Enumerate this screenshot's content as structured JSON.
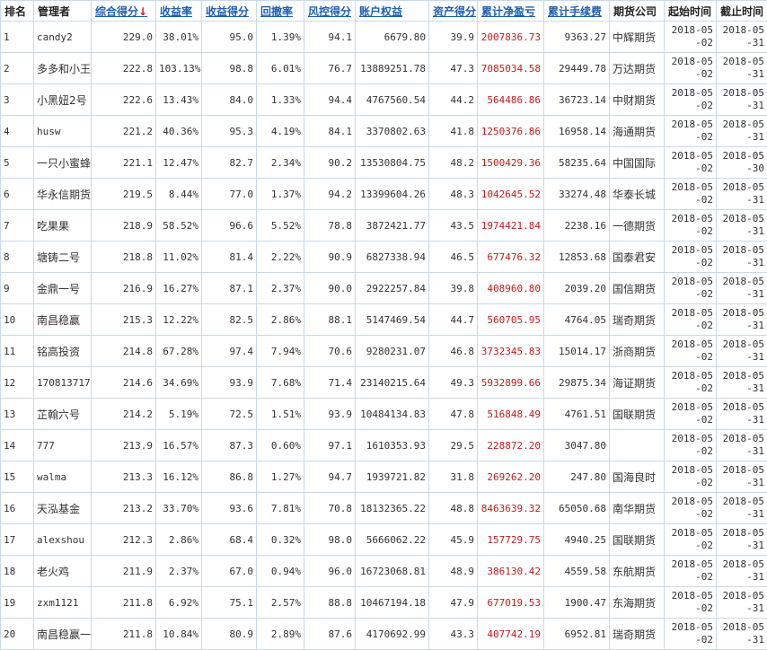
{
  "colors": {
    "header_link": "#1f5fb0",
    "sort_arrow": "#d01818",
    "profit_red": "#c01c1c",
    "grid": "#c8daea"
  },
  "sort_arrow_icon": "arrow-down-icon",
  "headers": {
    "rank": "排名",
    "manager": "管理者",
    "composite": "综合得分",
    "sort_arrow": "↓",
    "return_rate": "收益率",
    "return_score": "收益得分",
    "drawdown": "回撤率",
    "risk_score": "风控得分",
    "equity": "账户权益",
    "asset_score": "资产得分",
    "cum_profit": "累计净盈亏",
    "cum_fee": "累计手续费",
    "company": "期货公司",
    "start": "起始时间",
    "end": "截止时间"
  },
  "rows": [
    {
      "rank": "1",
      "manager": "candy2",
      "composite": "229.0",
      "return_rate": "38.01%",
      "return_score": "95.0",
      "drawdown": "1.39%",
      "risk_score": "94.1",
      "equity": "6679.80",
      "asset_score": "39.9",
      "cum_profit": "2007836.73",
      "cum_fee": "9363.27",
      "company": "中辉期货",
      "start": "2018-05-02",
      "end": "2018-05-31"
    },
    {
      "rank": "2",
      "manager": "多多和小王",
      "composite": "222.8",
      "return_rate": "103.13%",
      "return_score": "98.8",
      "drawdown": "6.01%",
      "risk_score": "76.7",
      "equity": "13889251.78",
      "asset_score": "47.3",
      "cum_profit": "7085034.58",
      "cum_fee": "29449.78",
      "company": "万达期货",
      "start": "2018-05-02",
      "end": "2018-05-31"
    },
    {
      "rank": "3",
      "manager": "小黑妞2号",
      "composite": "222.6",
      "return_rate": "13.43%",
      "return_score": "84.0",
      "drawdown": "1.33%",
      "risk_score": "94.4",
      "equity": "4767560.54",
      "asset_score": "44.2",
      "cum_profit": "564486.86",
      "cum_fee": "36723.14",
      "company": "中财期货",
      "start": "2018-05-02",
      "end": "2018-05-31"
    },
    {
      "rank": "4",
      "manager": "husw",
      "composite": "221.2",
      "return_rate": "40.36%",
      "return_score": "95.3",
      "drawdown": "4.19%",
      "risk_score": "84.1",
      "equity": "3370802.63",
      "asset_score": "41.8",
      "cum_profit": "1250376.86",
      "cum_fee": "16958.14",
      "company": "海通期货",
      "start": "2018-05-02",
      "end": "2018-05-31"
    },
    {
      "rank": "5",
      "manager": "一只小蜜蜂",
      "composite": "221.1",
      "return_rate": "12.47%",
      "return_score": "82.7",
      "drawdown": "2.34%",
      "risk_score": "90.2",
      "equity": "13530804.75",
      "asset_score": "48.2",
      "cum_profit": "1500429.36",
      "cum_fee": "58235.64",
      "company": "中国国际",
      "start": "2018-05-02",
      "end": "2018-05-30"
    },
    {
      "rank": "6",
      "manager": "华永信期货",
      "composite": "219.5",
      "return_rate": "8.44%",
      "return_score": "77.0",
      "drawdown": "1.37%",
      "risk_score": "94.2",
      "equity": "13399604.26",
      "asset_score": "48.3",
      "cum_profit": "1042645.52",
      "cum_fee": "33274.48",
      "company": "华泰长城",
      "start": "2018-05-02",
      "end": "2018-05-31"
    },
    {
      "rank": "7",
      "manager": "吃果果",
      "composite": "218.9",
      "return_rate": "58.52%",
      "return_score": "96.6",
      "drawdown": "5.52%",
      "risk_score": "78.8",
      "equity": "3872421.77",
      "asset_score": "43.5",
      "cum_profit": "1974421.84",
      "cum_fee": "2238.16",
      "company": "一德期货",
      "start": "2018-05-02",
      "end": "2018-05-31"
    },
    {
      "rank": "8",
      "manager": "塘铸二号",
      "composite": "218.8",
      "return_rate": "11.02%",
      "return_score": "81.4",
      "drawdown": "2.22%",
      "risk_score": "90.9",
      "equity": "6827338.94",
      "asset_score": "46.5",
      "cum_profit": "677476.32",
      "cum_fee": "12853.68",
      "company": "国泰君安",
      "start": "2018-05-02",
      "end": "2018-05-31"
    },
    {
      "rank": "9",
      "manager": "金鼎一号",
      "composite": "216.9",
      "return_rate": "16.27%",
      "return_score": "87.1",
      "drawdown": "2.37%",
      "risk_score": "90.0",
      "equity": "2922257.84",
      "asset_score": "39.8",
      "cum_profit": "408960.80",
      "cum_fee": "2039.20",
      "company": "国信期货",
      "start": "2018-05-02",
      "end": "2018-05-31"
    },
    {
      "rank": "10",
      "manager": "南昌稳赢",
      "composite": "215.3",
      "return_rate": "12.22%",
      "return_score": "82.5",
      "drawdown": "2.86%",
      "risk_score": "88.1",
      "equity": "5147469.54",
      "asset_score": "44.7",
      "cum_profit": "560705.95",
      "cum_fee": "4764.05",
      "company": "瑞奇期货",
      "start": "2018-05-02",
      "end": "2018-05-31"
    },
    {
      "rank": "11",
      "manager": "铭高投资",
      "composite": "214.8",
      "return_rate": "67.28%",
      "return_score": "97.4",
      "drawdown": "7.94%",
      "risk_score": "70.6",
      "equity": "9280231.07",
      "asset_score": "46.8",
      "cum_profit": "3732345.83",
      "cum_fee": "15014.17",
      "company": "浙商期货",
      "start": "2018-05-02",
      "end": "2018-05-31"
    },
    {
      "rank": "12",
      "manager": "170813717",
      "composite": "214.6",
      "return_rate": "34.69%",
      "return_score": "93.9",
      "drawdown": "7.68%",
      "risk_score": "71.4",
      "equity": "23140215.64",
      "asset_score": "49.3",
      "cum_profit": "5932899.66",
      "cum_fee": "29875.34",
      "company": "海证期货",
      "start": "2018-05-02",
      "end": "2018-05-31"
    },
    {
      "rank": "13",
      "manager": "芷翰六号",
      "composite": "214.2",
      "return_rate": "5.19%",
      "return_score": "72.5",
      "drawdown": "1.51%",
      "risk_score": "93.9",
      "equity": "10484134.83",
      "asset_score": "47.8",
      "cum_profit": "516848.49",
      "cum_fee": "4761.51",
      "company": "国联期货",
      "start": "2018-05-02",
      "end": "2018-05-31"
    },
    {
      "rank": "14",
      "manager": "777",
      "composite": "213.9",
      "return_rate": "16.57%",
      "return_score": "87.3",
      "drawdown": "0.60%",
      "risk_score": "97.1",
      "equity": "1610353.93",
      "asset_score": "29.5",
      "cum_profit": "228872.20",
      "cum_fee": "3047.80",
      "company": "",
      "start": "2018-05-02",
      "end": "2018-05-31"
    },
    {
      "rank": "15",
      "manager": "walma",
      "composite": "213.3",
      "return_rate": "16.12%",
      "return_score": "86.8",
      "drawdown": "1.27%",
      "risk_score": "94.7",
      "equity": "1939721.82",
      "asset_score": "31.8",
      "cum_profit": "269262.20",
      "cum_fee": "247.80",
      "company": "国海良时",
      "start": "2018-05-02",
      "end": "2018-05-31"
    },
    {
      "rank": "16",
      "manager": "天泓基金",
      "composite": "213.2",
      "return_rate": "33.70%",
      "return_score": "93.6",
      "drawdown": "7.81%",
      "risk_score": "70.8",
      "equity": "18132365.22",
      "asset_score": "48.8",
      "cum_profit": "8463639.32",
      "cum_fee": "65050.68",
      "company": "南华期货",
      "start": "2018-05-02",
      "end": "2018-05-31"
    },
    {
      "rank": "17",
      "manager": "alexshou",
      "composite": "212.3",
      "return_rate": "2.86%",
      "return_score": "68.4",
      "drawdown": "0.32%",
      "risk_score": "98.0",
      "equity": "5666062.22",
      "asset_score": "45.9",
      "cum_profit": "157729.75",
      "cum_fee": "4940.25",
      "company": "国联期货",
      "start": "2018-05-02",
      "end": "2018-05-31"
    },
    {
      "rank": "18",
      "manager": "老火鸡",
      "composite": "211.9",
      "return_rate": "2.37%",
      "return_score": "67.0",
      "drawdown": "0.94%",
      "risk_score": "96.0",
      "equity": "16723068.81",
      "asset_score": "48.9",
      "cum_profit": "386130.42",
      "cum_fee": "4559.58",
      "company": "东航期货",
      "start": "2018-05-02",
      "end": "2018-05-31"
    },
    {
      "rank": "19",
      "manager": "zxm1121",
      "composite": "211.8",
      "return_rate": "6.92%",
      "return_score": "75.1",
      "drawdown": "2.57%",
      "risk_score": "88.8",
      "equity": "10467194.18",
      "asset_score": "47.9",
      "cum_profit": "677019.53",
      "cum_fee": "1900.47",
      "company": "东海期货",
      "start": "2018-05-02",
      "end": "2018-05-31"
    },
    {
      "rank": "20",
      "manager": "南昌稳赢一",
      "composite": "211.8",
      "return_rate": "10.84%",
      "return_score": "80.9",
      "drawdown": "2.89%",
      "risk_score": "87.6",
      "equity": "4170692.99",
      "asset_score": "43.3",
      "cum_profit": "407742.19",
      "cum_fee": "6952.81",
      "company": "瑞奇期货",
      "start": "2018-05-02",
      "end": "2018-05-31"
    }
  ]
}
